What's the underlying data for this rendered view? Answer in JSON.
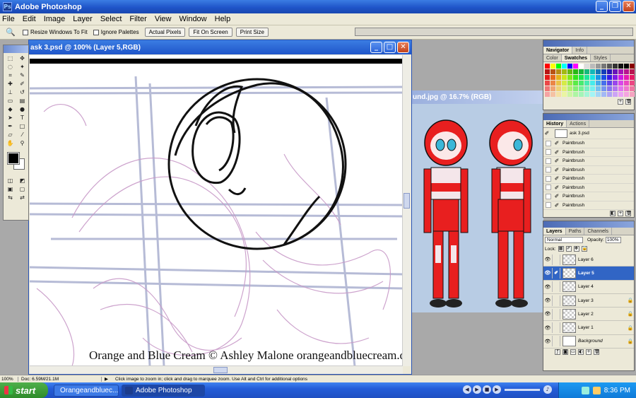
{
  "app": {
    "title": "Adobe Photoshop"
  },
  "menu": [
    "File",
    "Edit",
    "Image",
    "Layer",
    "Select",
    "Filter",
    "View",
    "Window",
    "Help"
  ],
  "options": {
    "resize_windows": "Resize Windows To Fit",
    "ignore_palettes": "Ignore Palettes",
    "actual_pixels": "Actual Pixels",
    "fit_on_screen": "Fit On Screen",
    "print_size": "Print Size"
  },
  "document1": {
    "title": "ask 3.psd @ 100% (Layer 5,RGB)"
  },
  "document2": {
    "title": "und.jpg @ 16.7% (RGB)"
  },
  "watermark": "Orange and Blue Cream © Ashley Malone orangeandbluecream.deviantart.com",
  "navigator": {
    "tabs": [
      "Navigator",
      "Info"
    ]
  },
  "swatches": {
    "tabs": [
      "Color",
      "Swatches",
      "Styles"
    ],
    "active": "Swatches"
  },
  "history": {
    "tabs": [
      "History",
      "Actions"
    ],
    "snapshot": "ask 3.psd",
    "items": [
      "Paintbrush",
      "Paintbrush",
      "Paintbrush",
      "Paintbrush",
      "Paintbrush",
      "Paintbrush",
      "Paintbrush",
      "Paintbrush"
    ]
  },
  "layers": {
    "tabs": [
      "Layers",
      "Paths",
      "Channels"
    ],
    "blend_mode": "Normal",
    "opacity_label": "Opacity:",
    "opacity": "100%",
    "lock_label": "Lock:",
    "items": [
      {
        "name": "Layer 6",
        "locked": false,
        "selected": false
      },
      {
        "name": "Layer 5",
        "locked": false,
        "selected": true
      },
      {
        "name": "Layer 4",
        "locked": false,
        "selected": false
      },
      {
        "name": "Layer 3",
        "locked": true,
        "selected": false
      },
      {
        "name": "Layer 2",
        "locked": true,
        "selected": false
      },
      {
        "name": "Layer 1",
        "locked": true,
        "selected": false
      },
      {
        "name": "Background",
        "locked": true,
        "selected": false
      }
    ]
  },
  "status": {
    "zoom": "100%",
    "doc": "Doc: 6.59M/21.1M",
    "hint": "Click image to zoom in; click and drag to marquee zoom.  Use Alt and Ctrl for additional options"
  },
  "taskbar": {
    "start": "start",
    "tasks": [
      "Orangeandbluec...",
      "Adobe Photoshop"
    ],
    "clock": "8:36 PM"
  }
}
